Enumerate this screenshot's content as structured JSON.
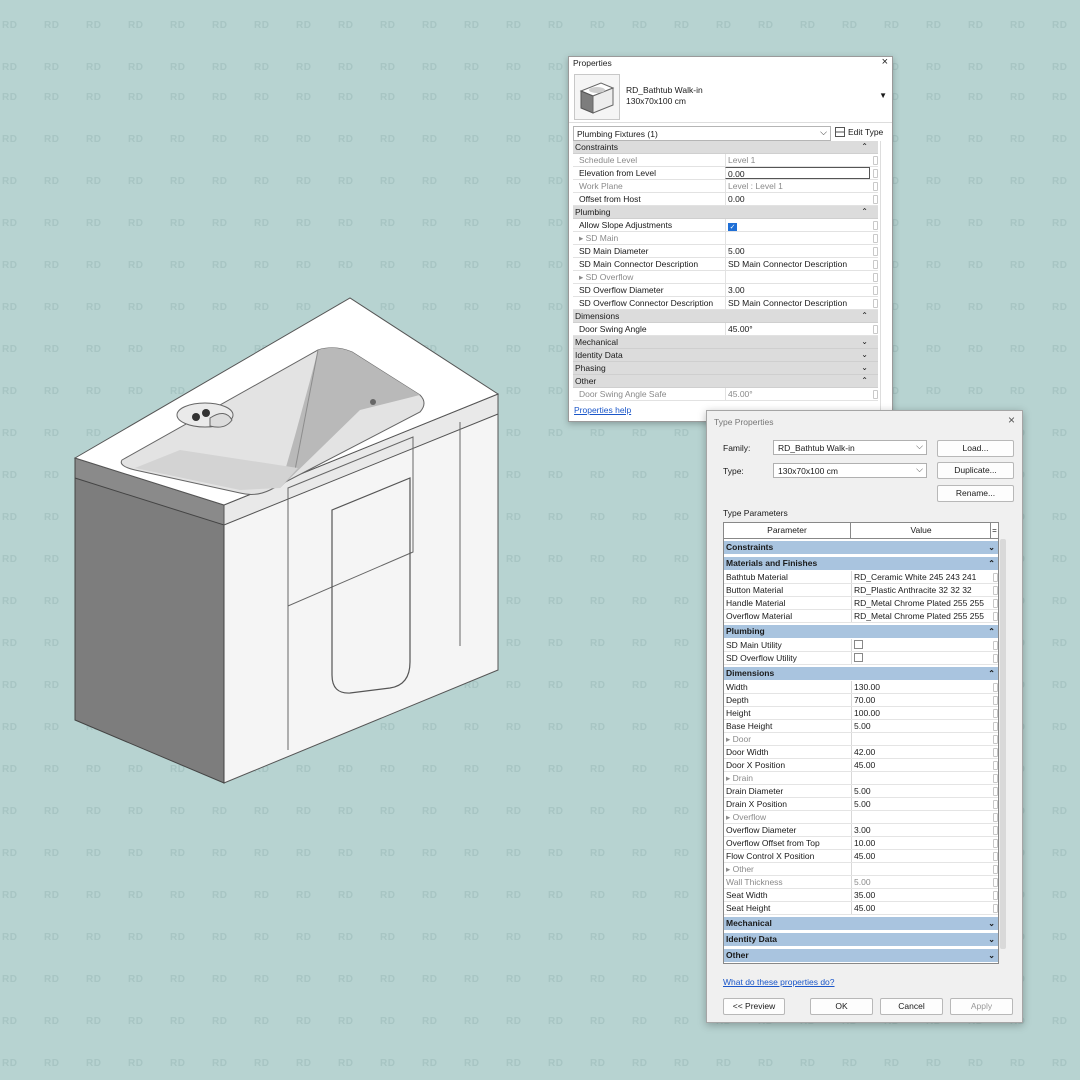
{
  "watermark": "RD",
  "properties": {
    "title": "Properties",
    "type_name": "RD_Bathtub Walk-in",
    "type_size": "130x70x100 cm",
    "filter": "Plumbing Fixtures (1)",
    "edit_type": "Edit Type",
    "help": "Properties help",
    "rows": [
      {
        "cat": "Constraints",
        "arrow": "up"
      },
      {
        "k": "Schedule Level",
        "v": "Level 1",
        "grey": true
      },
      {
        "k": "Elevation from Level",
        "v": "0.00",
        "active": true
      },
      {
        "k": "Work Plane",
        "v": "Level : Level 1",
        "grey": true
      },
      {
        "k": "Offset from Host",
        "v": "0.00"
      },
      {
        "cat": "Plumbing",
        "arrow": "up"
      },
      {
        "k": "Allow Slope Adjustments",
        "check": true
      },
      {
        "k": "▸ SD Main",
        "v": "",
        "grey": true
      },
      {
        "k": "SD Main Diameter",
        "v": "5.00"
      },
      {
        "k": "SD Main Connector Description",
        "v": "SD Main Connector Description"
      },
      {
        "k": "▸ SD Overflow",
        "v": "",
        "grey": true
      },
      {
        "k": "SD Overflow Diameter",
        "v": "3.00"
      },
      {
        "k": "SD Overflow Connector Description",
        "v": "SD Main Connector Description"
      },
      {
        "cat": "Dimensions",
        "arrow": "up"
      },
      {
        "k": "Door Swing Angle",
        "v": "45.00°"
      },
      {
        "cat": "Mechanical",
        "arrow": "down"
      },
      {
        "cat": "Identity Data",
        "arrow": "down"
      },
      {
        "cat": "Phasing",
        "arrow": "down"
      },
      {
        "cat": "Other",
        "arrow": "up"
      },
      {
        "k": "Door Swing Angle Safe",
        "v": "45.00°",
        "grey": true
      }
    ]
  },
  "type_dialog": {
    "title": "Type Properties",
    "family_label": "Family:",
    "family_value": "RD_Bathtub Walk-in",
    "type_label": "Type:",
    "type_value": "130x70x100 cm",
    "load": "Load...",
    "duplicate": "Duplicate...",
    "rename": "Rename...",
    "type_parameters": "Type Parameters",
    "col_parameter": "Parameter",
    "col_value": "Value",
    "col_equals": "=",
    "rows": [
      {
        "cat": "Constraints",
        "arrow": "down"
      },
      {
        "cat": "Materials and Finishes",
        "arrow": "up"
      },
      {
        "k": "Bathtub Material",
        "v": "RD_Ceramic White 245 243 241"
      },
      {
        "k": "Button Material",
        "v": "RD_Plastic Anthracite 32 32 32"
      },
      {
        "k": "Handle Material",
        "v": "RD_Metal Chrome Plated 255 255"
      },
      {
        "k": "Overflow Material",
        "v": "RD_Metal Chrome Plated 255 255"
      },
      {
        "cat": "Plumbing",
        "arrow": "up"
      },
      {
        "k": "SD Main Utility",
        "check": true
      },
      {
        "k": "SD Overflow Utility",
        "check": true
      },
      {
        "cat": "Dimensions",
        "arrow": "up"
      },
      {
        "k": "Width",
        "v": "130.00"
      },
      {
        "k": "Depth",
        "v": "70.00"
      },
      {
        "k": "Height",
        "v": "100.00"
      },
      {
        "k": "Base Height",
        "v": "5.00"
      },
      {
        "k": "▸ Door",
        "v": "",
        "sub": true
      },
      {
        "k": "Door Width",
        "v": "42.00"
      },
      {
        "k": "Door X Position",
        "v": "45.00"
      },
      {
        "k": "▸ Drain",
        "v": "",
        "sub": true
      },
      {
        "k": "Drain Diameter",
        "v": "5.00"
      },
      {
        "k": "Drain X Position",
        "v": "5.00"
      },
      {
        "k": "▸ Overflow",
        "v": "",
        "sub": true
      },
      {
        "k": "Overflow Diameter",
        "v": "3.00"
      },
      {
        "k": "Overflow Offset from Top",
        "v": "10.00"
      },
      {
        "k": "Flow Control X Position",
        "v": "45.00"
      },
      {
        "k": "▸ Other",
        "v": "",
        "sub": true
      },
      {
        "k": "Wall Thickness",
        "v": "5.00",
        "grey": true
      },
      {
        "k": "Seat Width",
        "v": "35.00"
      },
      {
        "k": "Seat Height",
        "v": "45.00"
      },
      {
        "cat": "Mechanical",
        "arrow": "down"
      },
      {
        "cat": "Identity Data",
        "arrow": "down"
      },
      {
        "cat": "Other",
        "arrow": "down"
      }
    ],
    "help_link": "What do these properties do?",
    "preview": "<< Preview",
    "ok": "OK",
    "cancel": "Cancel",
    "apply": "Apply"
  }
}
